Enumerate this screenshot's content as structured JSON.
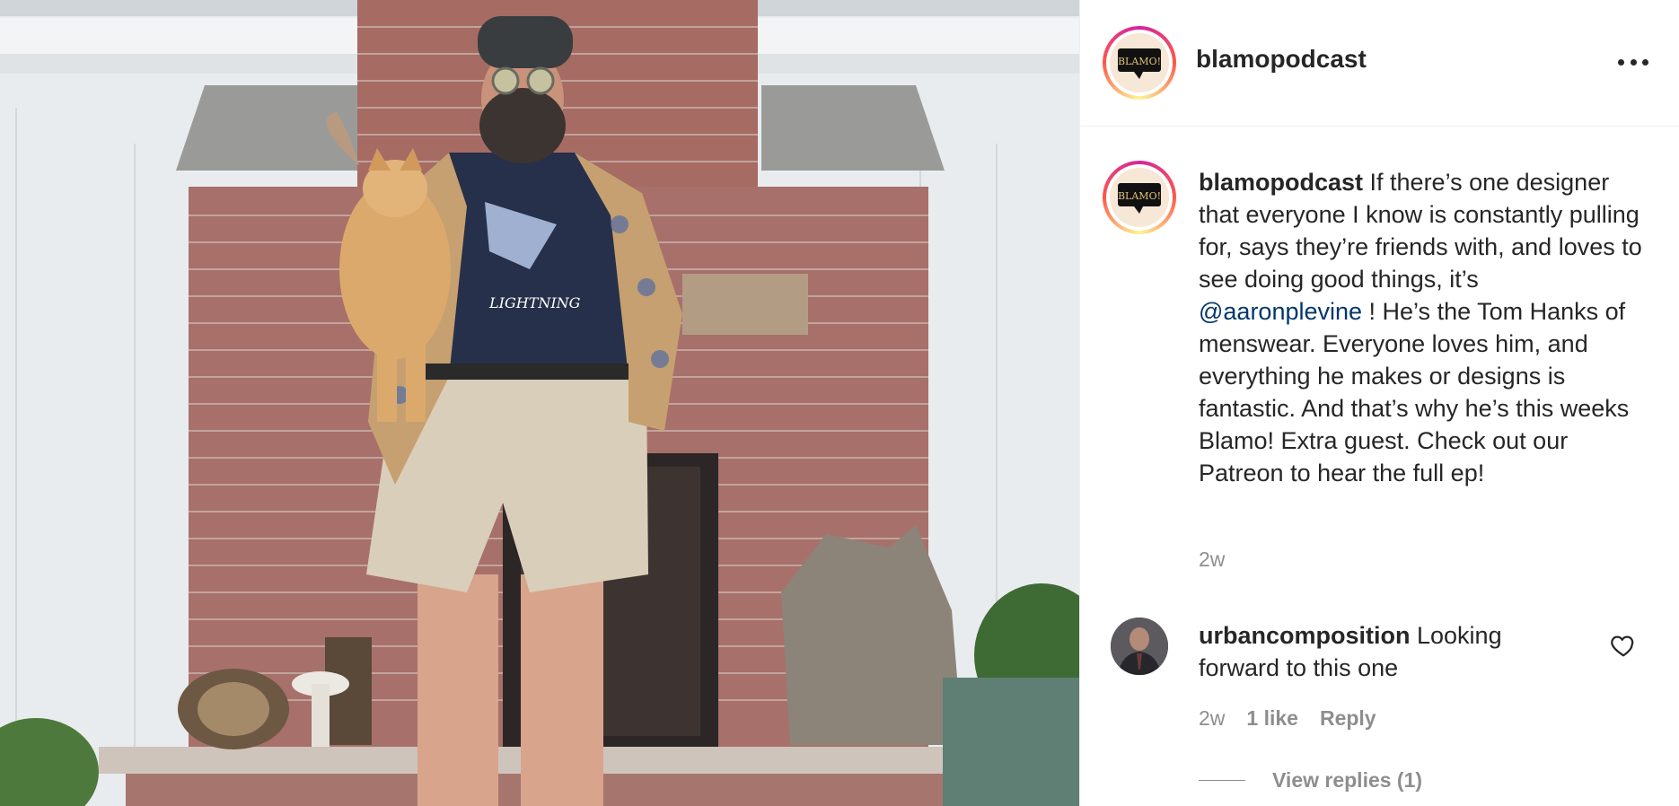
{
  "post": {
    "username": "blamopodcast",
    "avatar_label": "BLAMO!",
    "caption": {
      "username": "blamopodcast",
      "text_before": " If there’s one designer that everyone I know is constantly pulling for, says they’re friends with, and loves to see doing good things, it’s ",
      "mention": "@aaronplevine",
      "text_after": " ! He’s the Tom Hanks of menswear. Everyone loves him, and everything he makes or designs is fantastic. And that’s why he’s this weeks Blamo! Extra guest. Check out our Patreon to hear the full ep!",
      "time": "2w"
    },
    "photo": {
      "tshirt_text": "LIGHTNING"
    }
  },
  "comment": {
    "username": "urbancomposition",
    "text": " Looking forward to this one",
    "time": "2w",
    "likes": "1 like",
    "reply_label": "Reply",
    "view_replies": "View replies (1)"
  },
  "icons": {
    "more": "more-options-icon",
    "heart": "heart-icon"
  },
  "colors": {
    "mention": "#00376b",
    "secondary_text": "#8e8e8e",
    "primary_text": "#262626"
  }
}
